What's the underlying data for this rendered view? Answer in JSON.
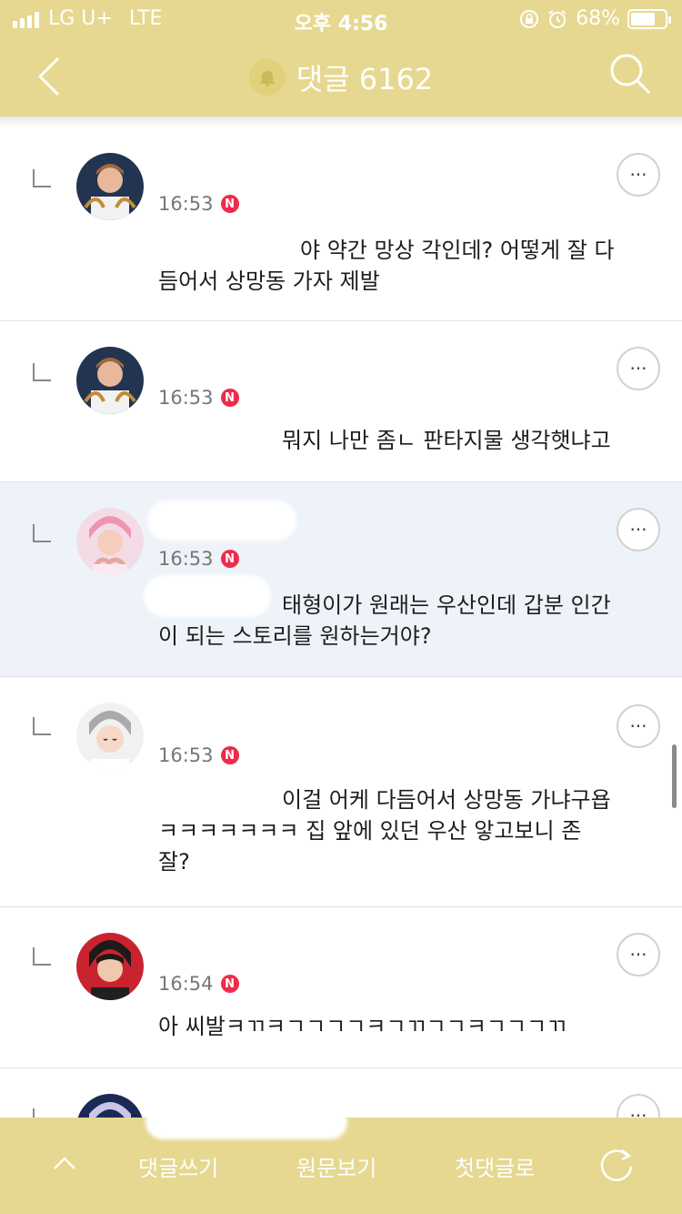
{
  "status_bar": {
    "carrier": "LG U+",
    "network": "LTE",
    "time": "오후 4:56",
    "battery_percent": "68%"
  },
  "header": {
    "title": "댓글 6162",
    "background_color": "#e6d890"
  },
  "comments": [
    {
      "time": "16:53",
      "badge": "N",
      "body_line1": "야 약간 망상 각인데? 어떻게 잘 다",
      "body_line2": "듬어서 상망동 가자 제발"
    },
    {
      "time": "16:53",
      "badge": "N",
      "body_line1": "뭐지 나만 좀ㄴ 판타지물 생각햇냐고"
    },
    {
      "time": "16:53",
      "badge": "N",
      "body_line1": "태형이가 원래는 우산인데 갑분 인간",
      "body_line2": "이 되는 스토리를 원하는거야?"
    },
    {
      "time": "16:53",
      "badge": "N",
      "body_line1": "이걸 어케 다듬어서 상망동 가냐구욥",
      "body_line2": "ㅋㅋㅋㅋㅋㅋㅋ 집 앞에 있던 우산 앟고보니 존",
      "body_line3": "잘?"
    },
    {
      "time": "16:54",
      "badge": "N",
      "body_line1": "아 씨발ㅋㄲㅋㄱㄱㄱㄱㅋㄱㄲㄱㄱㅋㄱㄱㄱㄲ"
    }
  ],
  "more_button_label": "···",
  "bottom_bar": {
    "write": "댓글쓰기",
    "original": "원문보기",
    "first": "첫댓글로"
  },
  "colors": {
    "accent": "#e6d890",
    "badge": "#ee2b4a",
    "highlight_row": "#eef3f9"
  }
}
